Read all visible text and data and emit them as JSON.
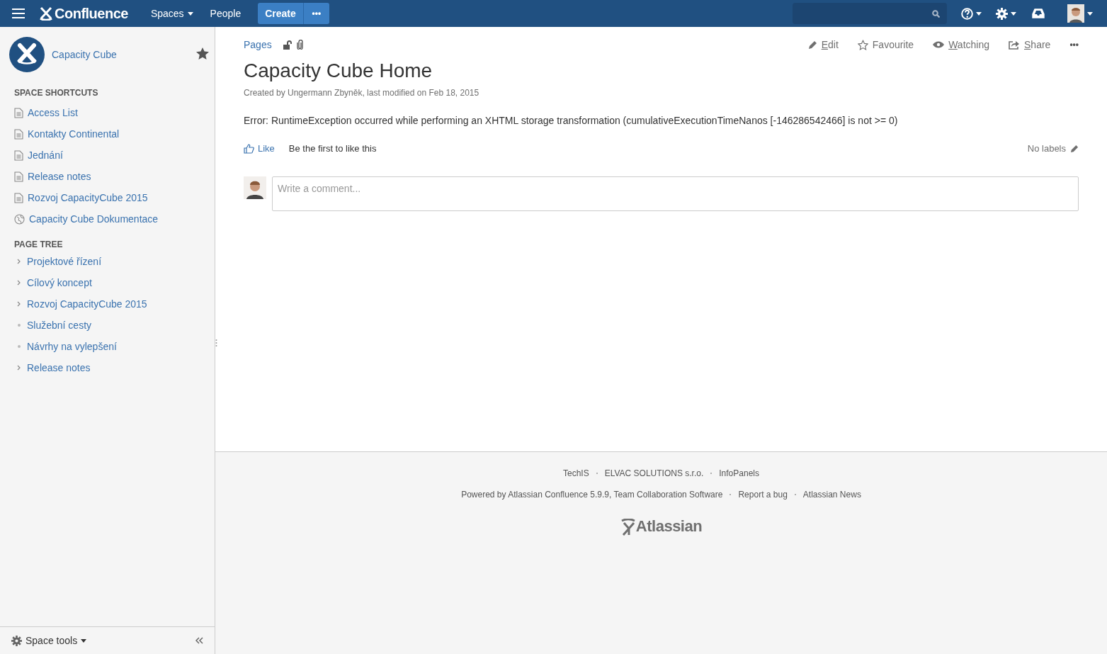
{
  "header": {
    "product": "Confluence",
    "nav": [
      {
        "label": "Spaces",
        "dropdown": true
      },
      {
        "label": "People",
        "dropdown": false
      }
    ],
    "create": "Create",
    "more": "•••"
  },
  "sidebar": {
    "space_name": "Capacity Cube",
    "favourite": true,
    "shortcuts_title": "SPACE SHORTCUTS",
    "shortcuts": [
      {
        "label": "Access List",
        "kind": "page"
      },
      {
        "label": "Kontakty Continental",
        "kind": "page"
      },
      {
        "label": "Jednání",
        "kind": "page"
      },
      {
        "label": "Release notes",
        "kind": "page"
      },
      {
        "label": "Rozvoj CapacityCube 2015",
        "kind": "page"
      },
      {
        "label": "Capacity Cube Dokumentace",
        "kind": "link"
      }
    ],
    "tree_title": "PAGE TREE",
    "tree": [
      {
        "label": "Projektové řízení",
        "kind": "parent",
        "expanded": false
      },
      {
        "label": "Cílový koncept",
        "kind": "parent",
        "expanded": false
      },
      {
        "label": "Rozvoj CapacityCube 2015",
        "kind": "parent",
        "expanded": false
      },
      {
        "label": "Služební cesty",
        "kind": "leaf"
      },
      {
        "label": "Návrhy na vylepšení",
        "kind": "leaf"
      },
      {
        "label": "Release notes",
        "kind": "parent",
        "expanded": false
      }
    ],
    "space_tools": "Space tools"
  },
  "page": {
    "breadcrumb": "Pages",
    "actions": [
      {
        "label": "Edit",
        "kind": "edit",
        "underline_first": true
      },
      {
        "label": "Favourite",
        "kind": "star",
        "underline_first": false
      },
      {
        "label": "Watching",
        "kind": "eye",
        "underline_first": true
      },
      {
        "label": "Share",
        "kind": "share",
        "underline_first": true
      }
    ],
    "more": "•••",
    "title": "Capacity Cube Home",
    "byline": "Created by Ungermann Zbyněk, last modified on Feb 18, 2015",
    "body": "Error: RuntimeException occurred while performing an XHTML storage transformation (cumulativeExecutionTimeNanos [-146286542466] is not >= 0)",
    "like": "Like",
    "like_note": "Be the first to like this",
    "labels": "No labels",
    "comment": {
      "placeholder": "Write a comment..."
    }
  },
  "footer": {
    "links": [
      "TechIS",
      "ELVAC SOLUTIONS s.r.o.",
      "InfoPanels"
    ],
    "links2": [
      "Powered by Atlassian Confluence 5.9.9, Team Collaboration Software",
      "Report a bug",
      "Atlassian News"
    ],
    "logo": "Atlassian"
  }
}
